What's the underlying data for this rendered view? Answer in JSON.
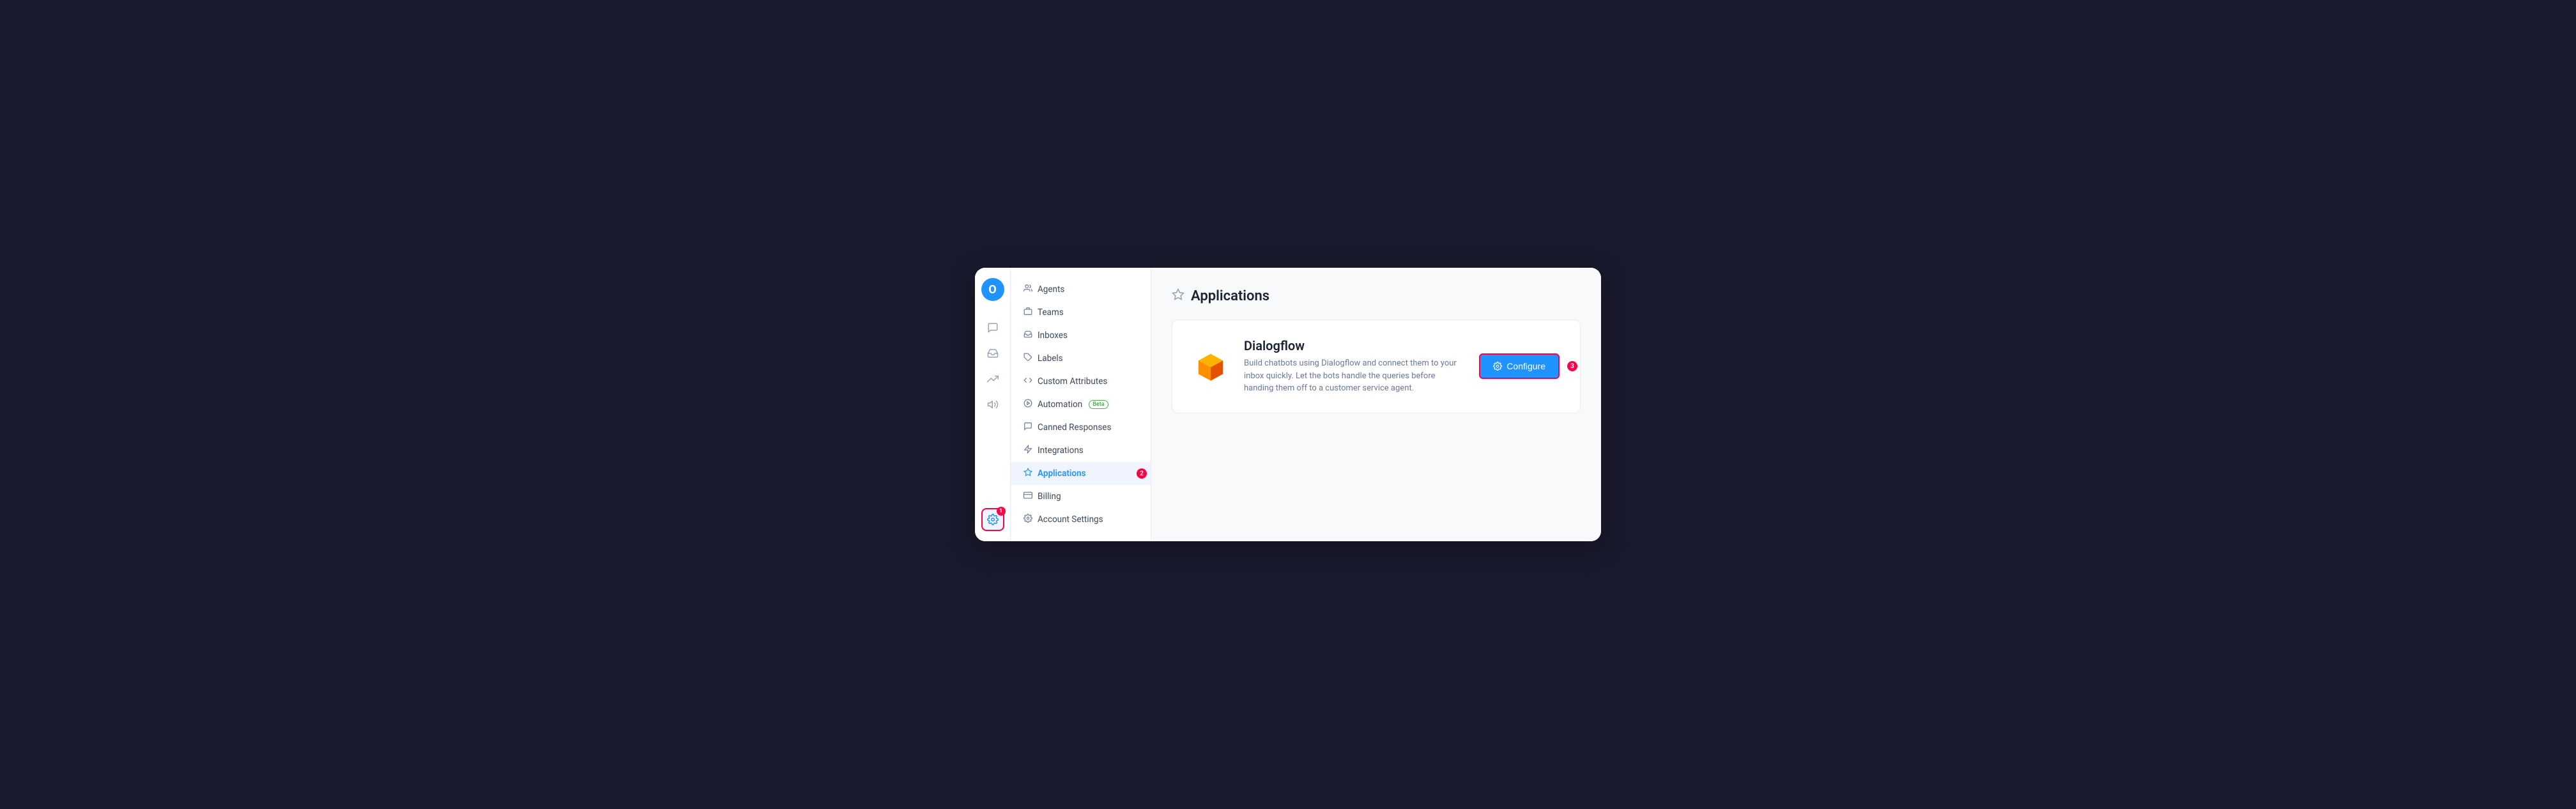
{
  "window": {
    "title": "Applications"
  },
  "rail": {
    "logo_letter": "O",
    "items": [
      {
        "name": "chat-icon",
        "icon": "💬",
        "active": false
      },
      {
        "name": "inbox-icon",
        "icon": "📥",
        "active": false
      },
      {
        "name": "reports-icon",
        "icon": "📈",
        "active": false
      },
      {
        "name": "campaigns-icon",
        "icon": "📢",
        "active": false
      },
      {
        "name": "settings-icon",
        "icon": "⚙️",
        "active": true,
        "highlighted": true,
        "badge": "1"
      }
    ]
  },
  "sidebar": {
    "items": [
      {
        "label": "Agents",
        "icon": "👤",
        "active": false,
        "name": "agents"
      },
      {
        "label": "Teams",
        "icon": "👥",
        "active": false,
        "name": "teams"
      },
      {
        "label": "Inboxes",
        "icon": "📧",
        "active": false,
        "name": "inboxes"
      },
      {
        "label": "Labels",
        "icon": "🏷️",
        "active": false,
        "name": "labels"
      },
      {
        "label": "Custom Attributes",
        "icon": "◇",
        "active": false,
        "name": "custom-attributes"
      },
      {
        "label": "Automation",
        "icon": "🚀",
        "active": false,
        "name": "automation",
        "badge": "Beta"
      },
      {
        "label": "Canned Responses",
        "icon": "💬",
        "active": false,
        "name": "canned-responses"
      },
      {
        "label": "Integrations",
        "icon": "⚡",
        "active": false,
        "name": "integrations"
      },
      {
        "label": "Applications",
        "icon": "☆",
        "active": true,
        "name": "applications",
        "highlighted": true,
        "badge_num": "2"
      },
      {
        "label": "Billing",
        "icon": "💳",
        "active": false,
        "name": "billing"
      },
      {
        "label": "Account Settings",
        "icon": "⚙️",
        "active": false,
        "name": "account-settings"
      }
    ]
  },
  "page": {
    "title": "Applications",
    "title_icon": "☆"
  },
  "dialogflow": {
    "name": "Dialogflow",
    "description": "Build chatbots using Dialogflow and connect them to your inbox quickly. Let the bots handle the queries before handing them off to a customer service agent.",
    "configure_label": "Configure",
    "configure_icon": "⚙️",
    "badge_num": "3"
  }
}
